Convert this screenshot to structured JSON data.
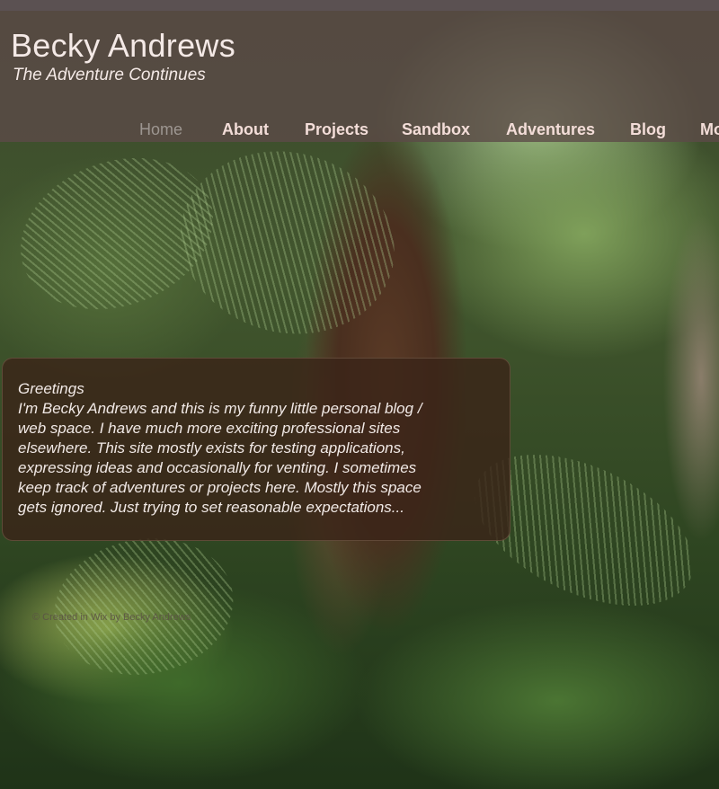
{
  "header": {
    "title": "Becky Andrews",
    "tagline": "The Adventure Continues"
  },
  "nav": {
    "items": [
      {
        "label": "Home",
        "active": true
      },
      {
        "label": "About"
      },
      {
        "label": "Projects"
      },
      {
        "label": "Sandbox"
      },
      {
        "label": "Adventures"
      },
      {
        "label": "Blog"
      },
      {
        "label": "Mo"
      }
    ]
  },
  "greeting": {
    "title": "Greetings",
    "body": "I'm Becky Andrews and this is my funny little personal blog /\nweb space.  I have much more exciting professional sites\nelsewhere. This site mostly exists for testing applications,\nexpressing ideas and occasionally for venting.  I sometimes\nkeep track of adventures or projects here.  Mostly this space\ngets ignored.  Just trying to set reasonable expectations..."
  },
  "footer": {
    "credit": "© Created in Wix by Becky Andrews"
  },
  "colors": {
    "header_bg": "#5c4a48",
    "title_text": "#f4e9e6",
    "nav_text": "#f3ddd8",
    "nav_active": "#9d9691",
    "box_bg": "#3a2418"
  }
}
